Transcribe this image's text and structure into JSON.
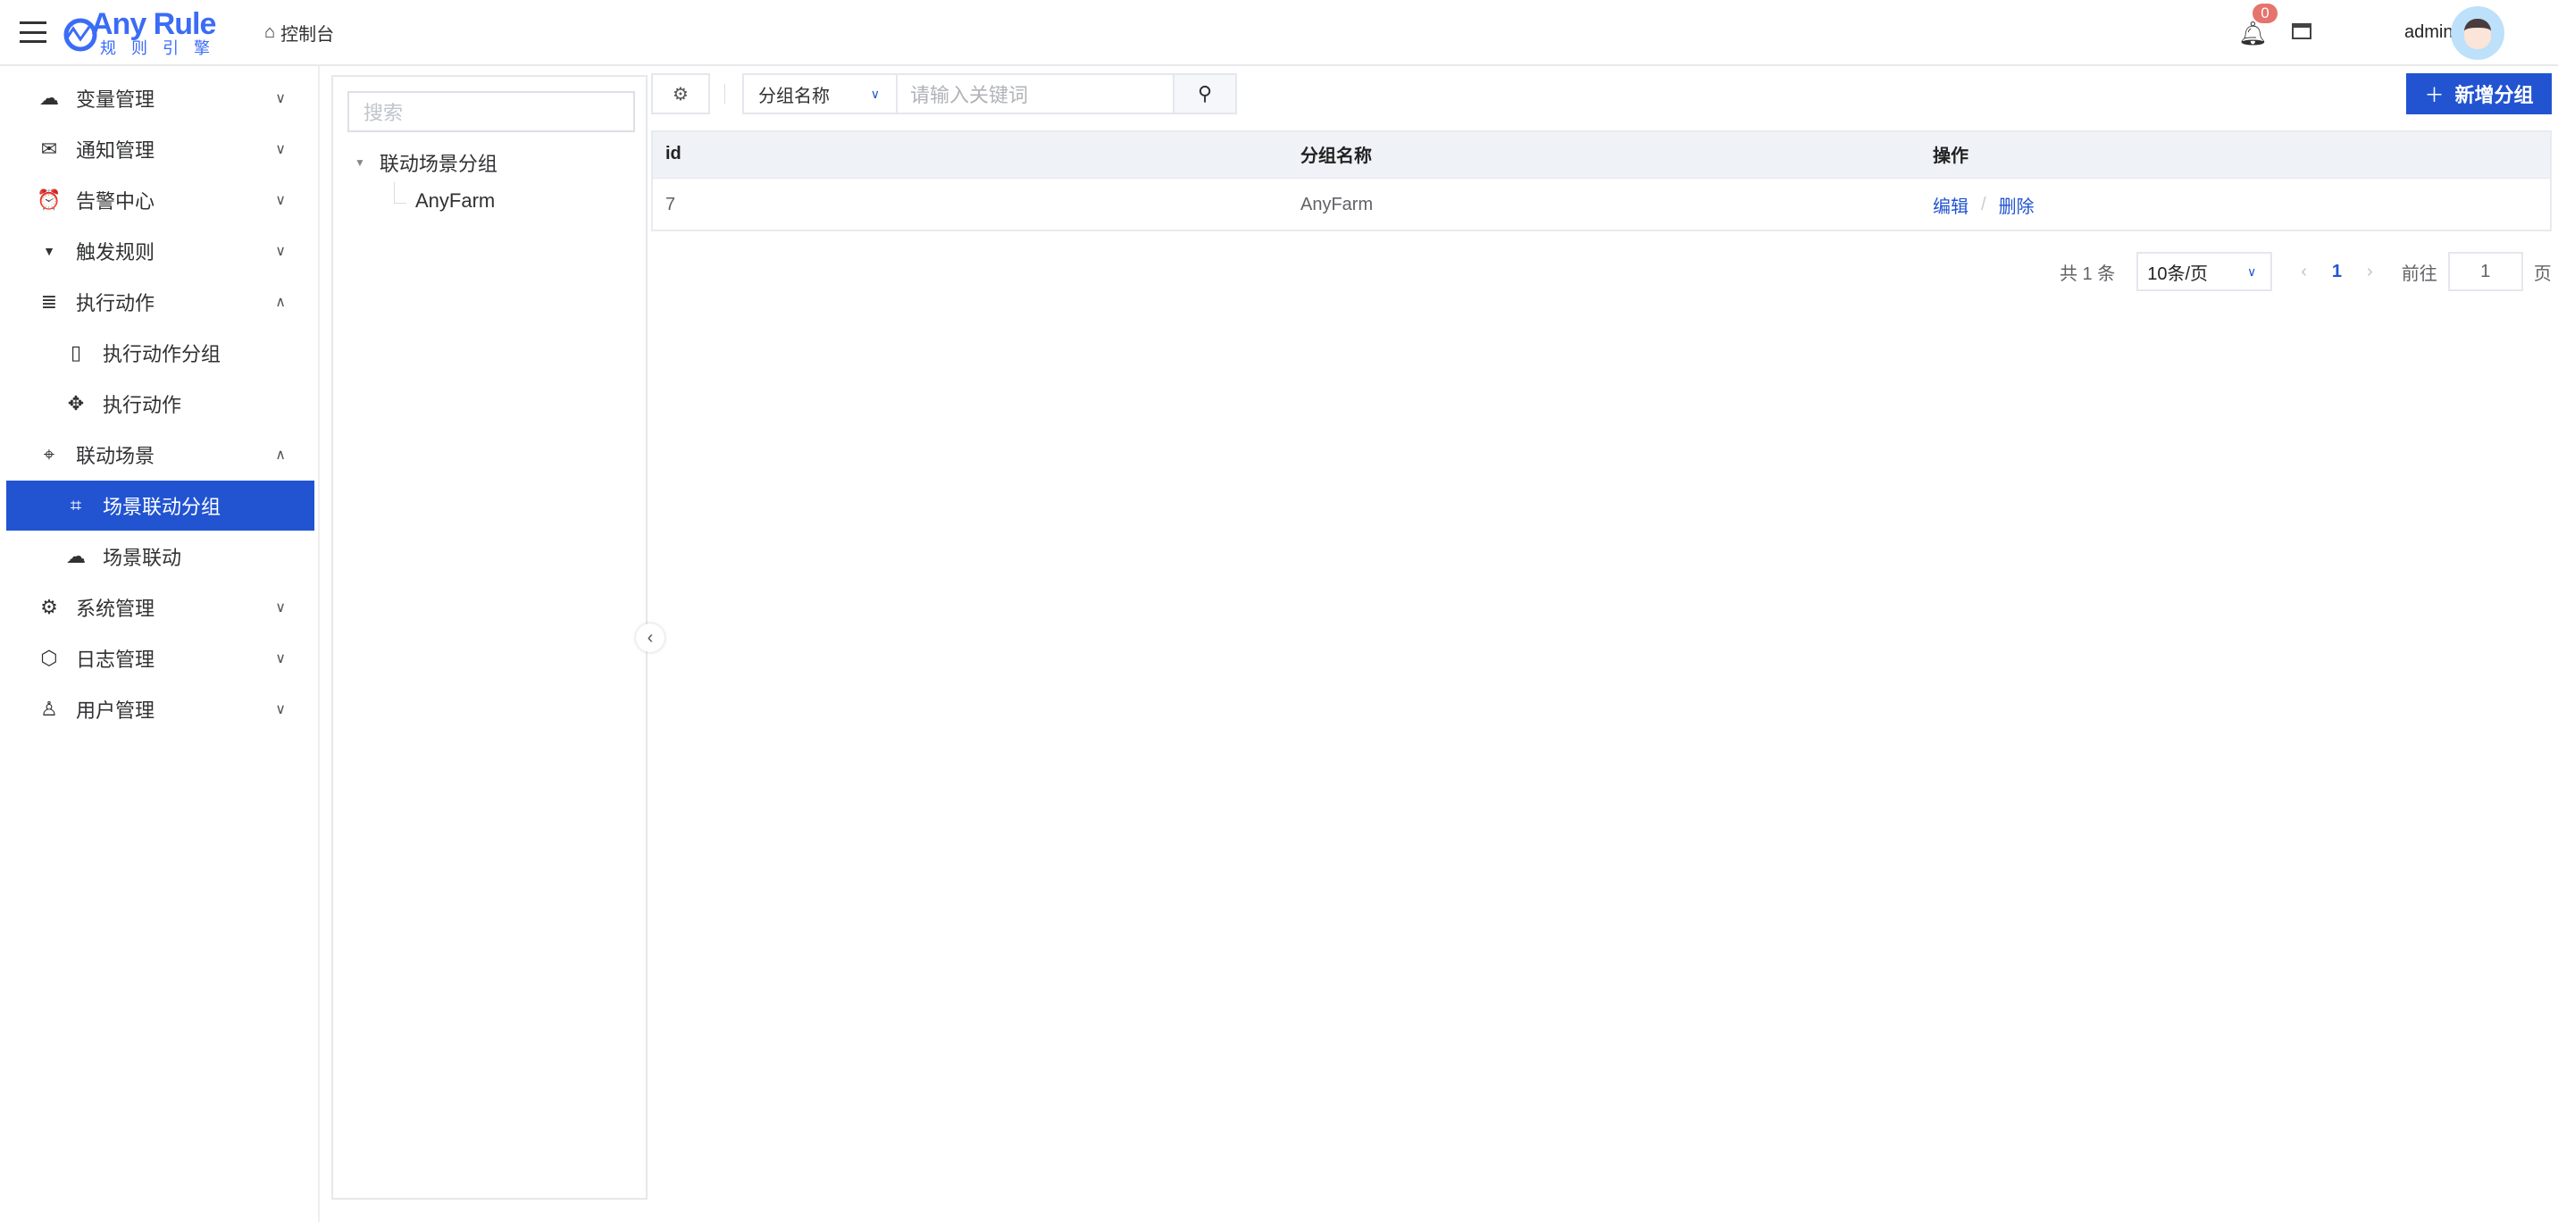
{
  "header": {
    "logo_en": "Any Rule",
    "logo_cn": "规则引擎",
    "breadcrumb": "控制台",
    "notification_count": "0",
    "username": "admin"
  },
  "sidebar": {
    "items": [
      {
        "label": "变量管理",
        "icon": "cloud-icon",
        "expanded": false
      },
      {
        "label": "通知管理",
        "icon": "mail-icon",
        "expanded": false
      },
      {
        "label": "告警中心",
        "icon": "alarm-clock-icon",
        "expanded": false
      },
      {
        "label": "触发规则",
        "icon": "caret-down-icon",
        "expanded": false
      },
      {
        "label": "执行动作",
        "icon": "database-icon",
        "expanded": true
      },
      {
        "label": "执行动作分组",
        "icon": "tablet-icon",
        "sub": true
      },
      {
        "label": "执行动作",
        "icon": "move-icon",
        "sub": true
      },
      {
        "label": "联动场景",
        "icon": "location-icon",
        "expanded": true
      },
      {
        "label": "场景联动分组",
        "icon": "crop-icon",
        "sub": true,
        "active": true
      },
      {
        "label": "场景联动",
        "icon": "upload-cloud-icon",
        "sub": true
      },
      {
        "label": "系统管理",
        "icon": "gear-icon",
        "expanded": false
      },
      {
        "label": "日志管理",
        "icon": "hexagon-icon",
        "expanded": false
      },
      {
        "label": "用户管理",
        "icon": "user-icon",
        "expanded": false
      }
    ]
  },
  "tree": {
    "search_placeholder": "搜索",
    "root": "联动场景分组",
    "children": [
      "AnyFarm"
    ]
  },
  "toolbar": {
    "select_value": "分组名称",
    "search_placeholder": "请输入关键词",
    "add_label": "新增分组"
  },
  "table": {
    "columns": [
      "id",
      "分组名称",
      "操作"
    ],
    "rows": [
      {
        "id": "7",
        "name": "AnyFarm",
        "actions": [
          "编辑",
          "删除"
        ]
      }
    ],
    "action_separator": "/"
  },
  "pagination": {
    "total": "共 1 条",
    "page_size": "10条/页",
    "current_page": "1",
    "goto_label": "前往",
    "goto_value": "1",
    "page_suffix": "页"
  },
  "colors": {
    "accent": "#2254d1",
    "badge": "#e6736d"
  }
}
